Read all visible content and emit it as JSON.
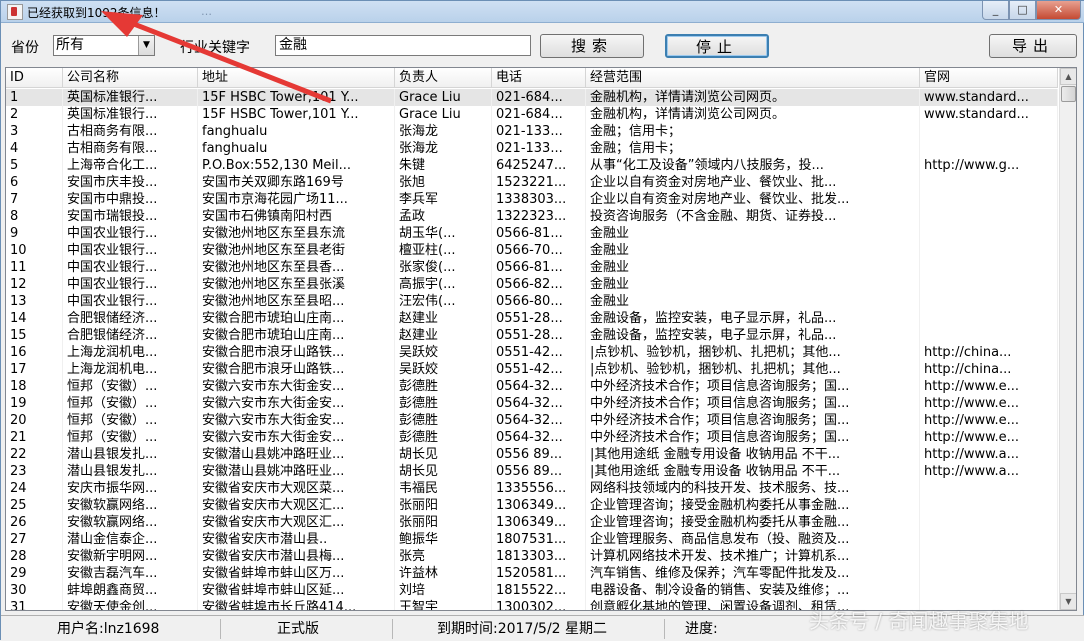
{
  "window": {
    "title": "已经获取到1092条信息！",
    "taskbar_ghost": "…",
    "min": "_",
    "max": "□",
    "close": "✕"
  },
  "controls": {
    "province_label": "省份",
    "province_value": "所有",
    "keyword_label": "行业关键字",
    "keyword_value": "金融",
    "search_label": "搜索",
    "stop_label": "停止",
    "export_label": "导出"
  },
  "columns": [
    "ID",
    "公司名称",
    "地址",
    "负责人",
    "电话",
    "经营范围",
    "官网"
  ],
  "rows": [
    [
      "1",
      "英国标准银行...",
      "15F HSBC Tower,101 Y...",
      "Grace Liu",
      "021-684...",
      "金融机构，详情请浏览公司网页。",
      "www.standard..."
    ],
    [
      "2",
      "英国标准银行...",
      "15F HSBC Tower,101 Y...",
      "Grace Liu",
      "021-684...",
      "金融机构，详情请浏览公司网页。",
      "www.standard..."
    ],
    [
      "3",
      "古相商务有限...",
      "fanghualu",
      "张海龙",
      "021-133...",
      "金融；信用卡；",
      ""
    ],
    [
      "4",
      "古相商务有限...",
      "fanghualu",
      "张海龙",
      "021-133...",
      "金融；信用卡；",
      ""
    ],
    [
      "5",
      "上海帝合化工...",
      "P.O.Box:552,130 Meil...",
      "朱键",
      "6425247...",
      "从事“化工及设备”领域内八技服务，投...",
      "http://www.g..."
    ],
    [
      "6",
      "安国市庆丰投...",
      "安国市关双卿东路169号",
      "张旭",
      "1523221...",
      "企业以自有资金对房地产业、餐饮业、批...",
      ""
    ],
    [
      "7",
      "安国市中鼎投...",
      "安国市京海花园广场11...",
      "李兵军",
      "1338303...",
      "企业以自有资金对房地产业、餐饮业、批发...",
      ""
    ],
    [
      "8",
      "安国市瑞银投...",
      "安国市石佛镇南阳村西",
      "孟政",
      "1322323...",
      "投资咨询服务（不含金融、期货、证券投...",
      ""
    ],
    [
      "9",
      "中国农业银行...",
      "安徽池州地区东至县东流",
      "胡玉华(...",
      "0566-81...",
      "金融业",
      ""
    ],
    [
      "10",
      "中国农业银行...",
      "安徽池州地区东至县老街",
      "檀亚柱(...",
      "0566-70...",
      "金融业",
      ""
    ],
    [
      "11",
      "中国农业银行...",
      "安徽池州地区东至县香...",
      "张家俊(...",
      "0566-81...",
      "金融业",
      ""
    ],
    [
      "12",
      "中国农业银行...",
      "安徽池州地区东至县张溪",
      "高振宇(...",
      "0566-82...",
      "金融业",
      ""
    ],
    [
      "13",
      "中国农业银行...",
      "安徽池州地区东至县昭...",
      "汪宏伟(...",
      "0566-80...",
      "金融业",
      ""
    ],
    [
      "14",
      "合肥银储经济...",
      "安徽合肥市琥珀山庄南...",
      "赵建业",
      "0551-28...",
      "金融设备，监控安装，电子显示屏，礼品...",
      ""
    ],
    [
      "15",
      "合肥银储经济...",
      "安徽合肥市琥珀山庄南...",
      "赵建业",
      "0551-28...",
      "金融设备，监控安装，电子显示屏，礼品...",
      ""
    ],
    [
      "16",
      "上海龙润机电...",
      "安徽合肥市浪牙山路铁...",
      "吴跃姣",
      "0551-42...",
      "|点钞机、验钞机，捆钞机、扎把机；其他...",
      "http://china..."
    ],
    [
      "17",
      "上海龙润机电...",
      "安徽合肥市浪牙山路铁...",
      "吴跃姣",
      "0551-42...",
      "|点钞机、验钞机，捆钞机、扎把机；其他...",
      "http://china..."
    ],
    [
      "18",
      "恒邦（安徽）...",
      "安徽六安市东大街金安...",
      "彭德胜",
      "0564-32...",
      "中外经济技术合作；项目信息咨询服务；国...",
      "http://www.e..."
    ],
    [
      "19",
      "恒邦（安徽）...",
      "安徽六安市东大街金安...",
      "彭德胜",
      "0564-32...",
      "中外经济技术合作；项目信息咨询服务；国...",
      "http://www.e..."
    ],
    [
      "20",
      "恒邦（安徽）...",
      "安徽六安市东大街金安...",
      "彭德胜",
      "0564-32...",
      "中外经济技术合作；项目信息咨询服务；国...",
      "http://www.e..."
    ],
    [
      "21",
      "恒邦（安徽）...",
      "安徽六安市东大街金安...",
      "彭德胜",
      "0564-32...",
      "中外经济技术合作；项目信息咨询服务；国...",
      "http://www.e..."
    ],
    [
      "22",
      "潜山县银发扎...",
      "安徽潜山县姚冲路旺业...",
      "胡长见",
      "0556 89...",
      "|其他用途纸 金融专用设备 收钠用品 不干...",
      "http://www.a..."
    ],
    [
      "23",
      "潜山县银发扎...",
      "安徽潜山县姚冲路旺业...",
      "胡长见",
      "0556 89...",
      "|其他用途纸 金融专用设备 收钠用品 不干...",
      "http://www.a..."
    ],
    [
      "24",
      "安庆市振华网...",
      "安徽省安庆市大观区菜...",
      "韦福民",
      "1335556...",
      "网络科技领域内的科技开发、技术服务、技...",
      ""
    ],
    [
      "25",
      "安徽软赢网络...",
      "安徽省安庆市大观区汇...",
      "张丽阳",
      "1306349...",
      "企业管理咨询；接受金融机构委托从事金融...",
      ""
    ],
    [
      "26",
      "安徽软赢网络...",
      "安徽省安庆市大观区汇...",
      "张丽阳",
      "1306349...",
      "企业管理咨询；接受金融机构委托从事金融...",
      ""
    ],
    [
      "27",
      "潜山金信泰企...",
      "安徽省安庆市潜山县..",
      "鲍振华",
      "1807531...",
      "企业管理服务、商品信息发布（投、融资及...",
      ""
    ],
    [
      "28",
      "安徽新宇明网...",
      "安徽省安庆市潜山县梅...",
      "张亮",
      "1813303...",
      "计算机网络技术开发、技术推广；计算机系...",
      ""
    ],
    [
      "29",
      "安徽吉磊汽车...",
      "安徽省蚌埠市蚌山区万...",
      "许益林",
      "1520581...",
      "汽车销售、维修及保养；汽车零配件批发及...",
      ""
    ],
    [
      "30",
      "蚌埠朗鑫商贸...",
      "安徽省蚌埠市蚌山区延...",
      "刘培",
      "1815522...",
      "电器设备、制冷设备的销售、安装及维修；...",
      ""
    ],
    [
      "31",
      "安徽天使金创...",
      "安徽省蚌埠市长丘路414...",
      "王智宇",
      "1300302...",
      "创意孵化基地的管理、闲置设备调剂、租赁...",
      ""
    ]
  ],
  "status": {
    "user": "用户名:lnz1698",
    "edition": "正式版",
    "expiry": "到期时间:2017/5/2 星期二",
    "progress_label": "进度:"
  },
  "watermark": "头条号 / 奇闻趣事聚集地",
  "colors": {
    "arrow": "#e53935",
    "selected_row": "#e5e5e5"
  }
}
